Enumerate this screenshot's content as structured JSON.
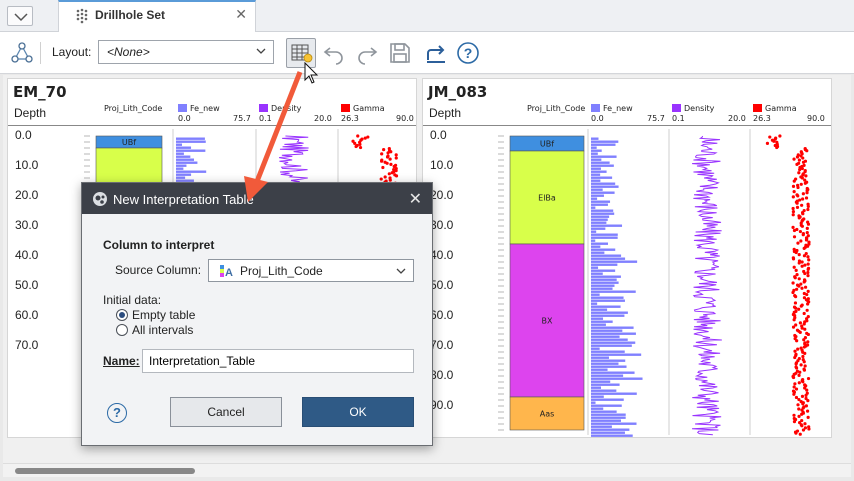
{
  "tab": {
    "title": "Drillhole Set",
    "close": "✕"
  },
  "toolbar": {
    "layout_label": "Layout:",
    "layout_value": "<None>"
  },
  "colors": {
    "fe": "#8080ff",
    "density": "#9933ff",
    "gamma": "#ff0000",
    "ubf": "#3f8fe0",
    "elba": "#d8ff4a",
    "bx": "#dd44ee",
    "aas": "#ffb64c",
    "accent": "#2f5a86",
    "arrow": "#f15a3a"
  },
  "columns": {
    "depth": "Depth",
    "lith": "Proj_Lith_Code",
    "fe": "Fe_new",
    "fe_range": [
      "0.0",
      "75.7"
    ],
    "density": "Density",
    "density_range": [
      "0.1",
      "20.0"
    ],
    "gamma": "Gamma",
    "gamma_range": [
      "26.3",
      "90.0"
    ]
  },
  "holes": [
    {
      "name": "EM_70",
      "depth_ticks": [
        "0.0",
        "10.0",
        "20.0",
        "30.0",
        "40.0",
        "50.0",
        "60.0",
        "70.0"
      ],
      "lith": [
        {
          "code": "UBf",
          "from": 0,
          "to": 4
        },
        {
          "code": "",
          "from": 4,
          "to": 28
        }
      ]
    },
    {
      "name": "JM_083",
      "depth_ticks": [
        "0.0",
        "10.0",
        "20.0",
        "30.0",
        "40.0",
        "50.0",
        "60.0",
        "70.0",
        "80.0",
        "90.0"
      ],
      "lith": [
        {
          "code": "UBf",
          "from": 0,
          "to": 5
        },
        {
          "code": "ElBa",
          "from": 5,
          "to": 36
        },
        {
          "code": "BX",
          "from": 36,
          "to": 87
        },
        {
          "code": "Aas",
          "from": 87,
          "to": 98
        }
      ]
    }
  ],
  "dialog": {
    "title": "New Interpretation Table",
    "section": "Column to interpret",
    "source_label": "Source Column:",
    "source_value": "Proj_Lith_Code",
    "initial_label": "Initial data:",
    "option_empty": "Empty table",
    "option_all": "All intervals",
    "selected": "empty",
    "name_label": "Name:",
    "name_value": "Interpretation_Table",
    "cancel": "Cancel",
    "ok": "OK",
    "help": "?"
  }
}
